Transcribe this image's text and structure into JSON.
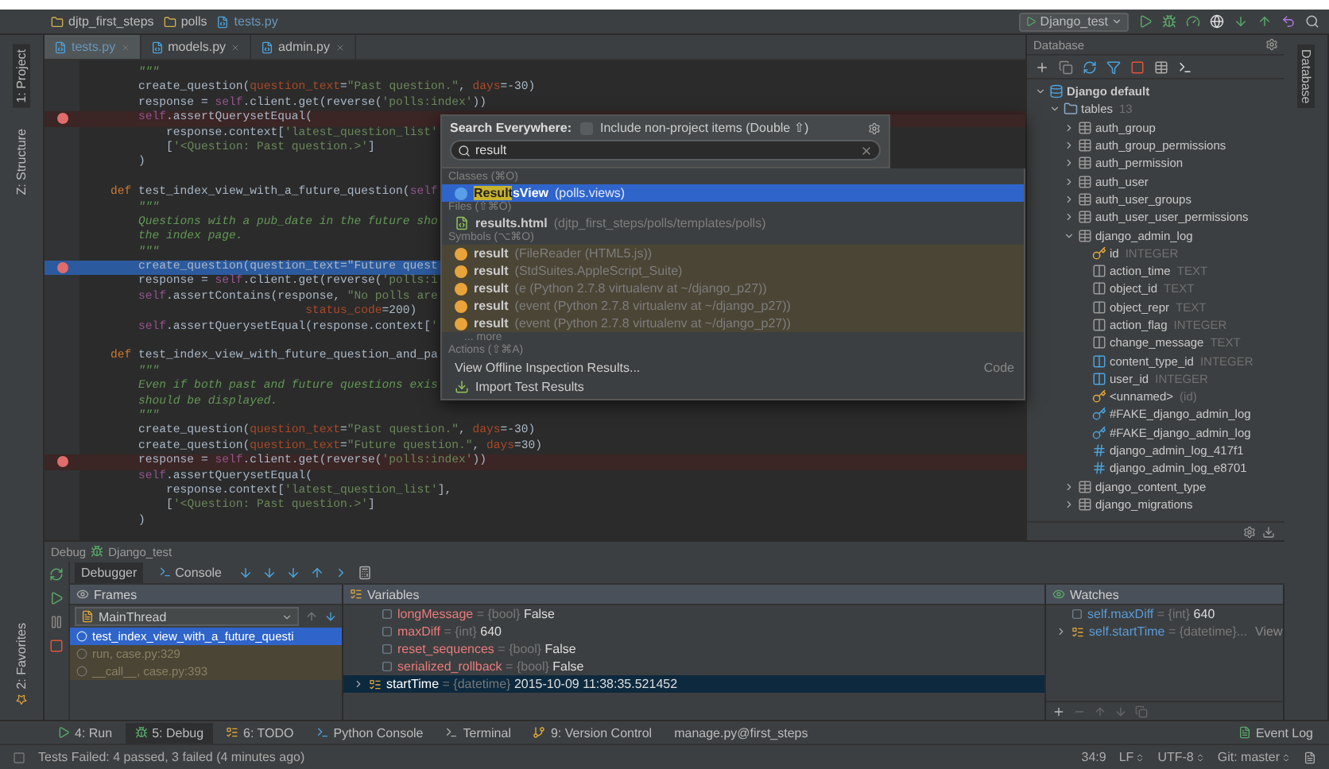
{
  "breadcrumbs": [
    {
      "label": "djtp_first_steps",
      "kind": "folder"
    },
    {
      "label": "polls",
      "kind": "folder"
    },
    {
      "label": "tests.py",
      "kind": "file"
    }
  ],
  "run_config": "Django_test",
  "left_strip": [
    {
      "label": "1: Project",
      "selected": true
    },
    {
      "label": "Z: Structure",
      "selected": false
    }
  ],
  "favorites": "2: Favorites",
  "editor": {
    "tabs": [
      {
        "label": "tests.py",
        "selected": true
      },
      {
        "label": "models.py",
        "selected": false
      },
      {
        "label": "admin.py",
        "selected": false
      }
    ],
    "lines": [
      {
        "text": "        \"\"\"",
        "kind": "doc",
        "breakpoint": false,
        "current": false
      },
      {
        "text": "        create_question(question_text=\"Past question.\", days=-30)",
        "kind": "code",
        "breakpoint": false,
        "current": false
      },
      {
        "text": "        response = self.client.get(reverse('polls:index'))",
        "kind": "code",
        "breakpoint": false,
        "current": false
      },
      {
        "text": "        self.assertQuerysetEqual(",
        "kind": "code",
        "breakpoint": true,
        "current": false
      },
      {
        "text": "            response.context['latest_question_list'",
        "kind": "code",
        "breakpoint": false,
        "current": false
      },
      {
        "text": "            ['<Question: Past question.>']",
        "kind": "code",
        "breakpoint": false,
        "current": false
      },
      {
        "text": "        )",
        "kind": "code",
        "breakpoint": false,
        "current": false
      },
      {
        "kind": "blank",
        "breakpoint": false,
        "current": false
      },
      {
        "text": "    def test_index_view_with_a_future_question(self",
        "kind": "code",
        "breakpoint": false,
        "current": false
      },
      {
        "text": "        \"\"\"",
        "kind": "doc",
        "breakpoint": false,
        "current": false
      },
      {
        "text": "        Questions with a pub_date in the future sho",
        "kind": "doc",
        "breakpoint": false,
        "current": false
      },
      {
        "text": "        the index page.",
        "kind": "doc",
        "breakpoint": false,
        "current": false
      },
      {
        "text": "        \"\"\"",
        "kind": "doc",
        "breakpoint": false,
        "current": false
      },
      {
        "text": "        create_question(question_text=\"Future quest",
        "kind": "code",
        "breakpoint": true,
        "current": true
      },
      {
        "text": "        response = self.client.get(reverse('polls:i",
        "kind": "code",
        "breakpoint": false,
        "current": false
      },
      {
        "text": "        self.assertContains(response, \"No polls are",
        "kind": "code",
        "breakpoint": false,
        "current": false
      },
      {
        "text": "                                status_code=200)",
        "kind": "code",
        "breakpoint": false,
        "current": false
      },
      {
        "text": "        self.assertQuerysetEqual(response.context['",
        "kind": "code",
        "breakpoint": false,
        "current": false
      },
      {
        "kind": "blank",
        "breakpoint": false,
        "current": false
      },
      {
        "text": "    def test_index_view_with_future_question_and_pa",
        "kind": "code",
        "breakpoint": false,
        "current": false
      },
      {
        "text": "        \"\"\"",
        "kind": "doc",
        "breakpoint": false,
        "current": false
      },
      {
        "text": "        Even if both past and future questions exis",
        "kind": "doc",
        "breakpoint": false,
        "current": false
      },
      {
        "text": "        should be displayed.",
        "kind": "doc",
        "breakpoint": false,
        "current": false
      },
      {
        "text": "        \"\"\"",
        "kind": "doc",
        "breakpoint": false,
        "current": false
      },
      {
        "text": "        create_question(question_text=\"Past question.\", days=-30)",
        "kind": "code",
        "breakpoint": false,
        "current": false
      },
      {
        "text": "        create_question(question_text=\"Future question.\", days=30)",
        "kind": "code",
        "breakpoint": false,
        "current": false
      },
      {
        "text": "        response = self.client.get(reverse('polls:index'))",
        "kind": "code",
        "breakpoint": true,
        "current": false
      },
      {
        "text": "        self.assertQuerysetEqual(",
        "kind": "code",
        "breakpoint": false,
        "current": false
      },
      {
        "text": "            response.context['latest_question_list'],",
        "kind": "code",
        "breakpoint": false,
        "current": false
      },
      {
        "text": "            ['<Question: Past question.>']",
        "kind": "code",
        "breakpoint": false,
        "current": false
      },
      {
        "text": "        )",
        "kind": "code",
        "breakpoint": false,
        "current": false
      }
    ]
  },
  "search_popup": {
    "title": "Search Everywhere:",
    "include_label": "Include non-project items (Double ⇧)",
    "include_checked": false,
    "query": "result",
    "sections": [
      {
        "header": "Classes (⌘O)",
        "items": [
          {
            "kind": "class",
            "match": "Result",
            "label": "sView",
            "detail": "(polls.views)",
            "selected": true
          }
        ]
      },
      {
        "header": "Files (⇧⌘O)",
        "items": [
          {
            "kind": "file",
            "label": "results.html",
            "detail": "(djtp_first_steps/polls/templates/polls)",
            "selected": false
          }
        ]
      },
      {
        "header": "Symbols (⌥⌘O)",
        "items": [
          {
            "kind": "symbol",
            "label": "result",
            "detail": "(FileReader (HTML5.js))",
            "selected": false
          },
          {
            "kind": "symbol",
            "label": "result",
            "detail": "(StdSuites.AppleScript_Suite)",
            "selected": false
          },
          {
            "kind": "symbol",
            "label": "result",
            "detail": "(e (Python 2.7.8 virtualenv at ~/django_p27))",
            "selected": false
          },
          {
            "kind": "symbol",
            "label": "result",
            "detail": "(event (Python 2.7.8 virtualenv at ~/django_p27))",
            "selected": false
          },
          {
            "kind": "symbol",
            "label": "result",
            "detail": "(event (Python 2.7.8 virtualenv at ~/django_p27))",
            "selected": false
          }
        ],
        "more": "... more"
      },
      {
        "header": "Actions (⇧⌘A)",
        "items": [
          {
            "kind": "action",
            "label": "View Offline Inspection Results...",
            "group": "Code",
            "selected": false
          },
          {
            "kind": "import",
            "label": "Import Test Results",
            "selected": false
          }
        ]
      }
    ]
  },
  "database": {
    "title": "Database",
    "tree": [
      {
        "label": "Django default",
        "kind": "source",
        "expanded": true,
        "children": [
          {
            "label": "tables",
            "count": "13",
            "kind": "folder",
            "expanded": true,
            "children": [
              {
                "label": "auth_group",
                "kind": "table",
                "expanded": false
              },
              {
                "label": "auth_group_permissions",
                "kind": "table",
                "expanded": false
              },
              {
                "label": "auth_permission",
                "kind": "table",
                "expanded": false
              },
              {
                "label": "auth_user",
                "kind": "table",
                "expanded": false
              },
              {
                "label": "auth_user_groups",
                "kind": "table",
                "expanded": false
              },
              {
                "label": "auth_user_user_permissions",
                "kind": "table",
                "expanded": false
              },
              {
                "label": "django_admin_log",
                "kind": "table",
                "expanded": true,
                "children": [
                  {
                    "label": "id",
                    "type": "INTEGER",
                    "kind": "key"
                  },
                  {
                    "label": "action_time",
                    "type": "TEXT",
                    "kind": "column"
                  },
                  {
                    "label": "object_id",
                    "type": "TEXT",
                    "kind": "column"
                  },
                  {
                    "label": "object_repr",
                    "type": "TEXT",
                    "kind": "column"
                  },
                  {
                    "label": "action_flag",
                    "type": "INTEGER",
                    "kind": "column"
                  },
                  {
                    "label": "change_message",
                    "type": "TEXT",
                    "kind": "column"
                  },
                  {
                    "label": "content_type_id",
                    "type": "INTEGER",
                    "kind": "fkcolumn"
                  },
                  {
                    "label": "user_id",
                    "type": "INTEGER",
                    "kind": "fkcolumn"
                  },
                  {
                    "label": "<unnamed>",
                    "type": "(id)",
                    "kind": "key"
                  },
                  {
                    "label": "#FAKE_django_admin_log",
                    "kind": "fkey"
                  },
                  {
                    "label": "#FAKE_django_admin_log",
                    "kind": "fkey"
                  },
                  {
                    "label": "django_admin_log_417f1",
                    "kind": "index"
                  },
                  {
                    "label": "django_admin_log_e8701",
                    "kind": "index"
                  }
                ]
              },
              {
                "label": "django_content_type",
                "kind": "table",
                "expanded": false
              },
              {
                "label": "django_migrations",
                "kind": "table",
                "expanded": false
              }
            ]
          }
        ]
      }
    ]
  },
  "right_strip": {
    "label": "Database",
    "selected": true
  },
  "debug": {
    "title": "Debug",
    "config": "Django_test",
    "tabs": [
      {
        "label": "Debugger",
        "selected": true
      },
      {
        "label": "Console",
        "selected": false
      }
    ],
    "frames_title": "Frames",
    "thread": "MainThread",
    "frames": [
      {
        "label": "test_index_view_with_a_future_questi",
        "selected": true
      },
      {
        "label": "run, case.py:329",
        "selected": false
      },
      {
        "label": "__call__, case.py:393",
        "selected": false
      }
    ],
    "variables_title": "Variables",
    "variables": [
      {
        "name": "longMessage",
        "type": "= {bool}",
        "value": "False",
        "expandable": false,
        "selected": false
      },
      {
        "name": "maxDiff",
        "type": "= {int}",
        "value": "640",
        "expandable": false,
        "selected": false
      },
      {
        "name": "reset_sequences",
        "type": "= {bool}",
        "value": "False",
        "expandable": false,
        "selected": false
      },
      {
        "name": "serialized_rollback",
        "type": "= {bool}",
        "value": "False",
        "expandable": false,
        "selected": false
      },
      {
        "name": "startTime",
        "type": "= {datetime}",
        "value": "2015-10-09 11:38:35.521452",
        "expandable": true,
        "selected": true
      }
    ],
    "watches_title": "Watches",
    "watches": [
      {
        "name": "self.maxDiff",
        "type": "= {int}",
        "value": "640",
        "expandable": false
      },
      {
        "name": "self.startTime",
        "type": "= {datetime}...",
        "link": "View",
        "expandable": true
      }
    ]
  },
  "tool_tabs": [
    {
      "label": "4: Run",
      "kind": "run",
      "selected": false
    },
    {
      "label": "5: Debug",
      "kind": "debug",
      "selected": true
    },
    {
      "label": "6: TODO",
      "kind": "todo",
      "selected": false
    },
    {
      "label": "Python Console",
      "kind": "console",
      "selected": false
    },
    {
      "label": "Terminal",
      "kind": "terminal",
      "selected": false
    },
    {
      "label": "9: Version Control",
      "kind": "vcs",
      "selected": false
    },
    {
      "label": "manage.py@first_steps",
      "kind": "plain",
      "selected": false
    }
  ],
  "event_log": "Event Log",
  "status": {
    "message": "Tests Failed: 4 passed, 3 failed (4 minutes ago)",
    "position": "34:9",
    "line_sep": "LF",
    "encoding": "UTF-8",
    "branch": "Git: master"
  }
}
